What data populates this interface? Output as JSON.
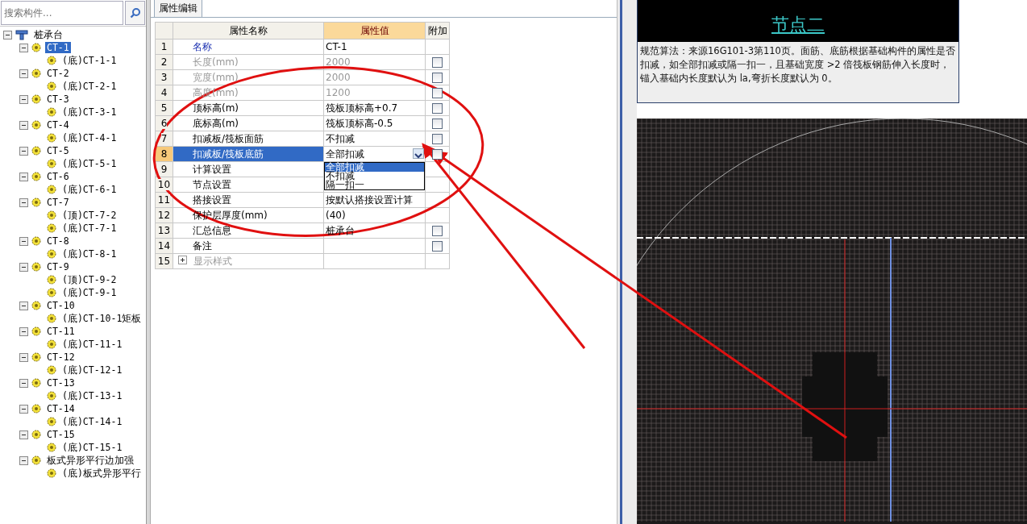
{
  "search": {
    "placeholder": "搜索构件..."
  },
  "tree": [
    {
      "label": "桩承台",
      "kind": "root",
      "expanded": true,
      "selected": false,
      "children": [
        {
          "label": "CT-1",
          "kind": "group",
          "expanded": true,
          "selected": true,
          "children": [
            {
              "label": "(底)CT-1-1",
              "kind": "leaf",
              "selected": false
            }
          ]
        },
        {
          "label": "CT-2",
          "kind": "group",
          "expanded": true,
          "selected": false,
          "children": [
            {
              "label": "(底)CT-2-1",
              "kind": "leaf",
              "selected": false
            }
          ]
        },
        {
          "label": "CT-3",
          "kind": "group",
          "expanded": true,
          "selected": false,
          "children": [
            {
              "label": "(底)CT-3-1",
              "kind": "leaf",
              "selected": false
            }
          ]
        },
        {
          "label": "CT-4",
          "kind": "group",
          "expanded": true,
          "selected": false,
          "children": [
            {
              "label": "(底)CT-4-1",
              "kind": "leaf",
              "selected": false
            }
          ]
        },
        {
          "label": "CT-5",
          "kind": "group",
          "expanded": true,
          "selected": false,
          "children": [
            {
              "label": "(底)CT-5-1",
              "kind": "leaf",
              "selected": false
            }
          ]
        },
        {
          "label": "CT-6",
          "kind": "group",
          "expanded": true,
          "selected": false,
          "children": [
            {
              "label": "(底)CT-6-1",
              "kind": "leaf",
              "selected": false
            }
          ]
        },
        {
          "label": "CT-7",
          "kind": "group",
          "expanded": true,
          "selected": false,
          "children": [
            {
              "label": "(顶)CT-7-2",
              "kind": "leaf",
              "selected": false
            },
            {
              "label": "(底)CT-7-1",
              "kind": "leaf",
              "selected": false
            }
          ]
        },
        {
          "label": "CT-8",
          "kind": "group",
          "expanded": true,
          "selected": false,
          "children": [
            {
              "label": "(底)CT-8-1",
              "kind": "leaf",
              "selected": false
            }
          ]
        },
        {
          "label": "CT-9",
          "kind": "group",
          "expanded": true,
          "selected": false,
          "children": [
            {
              "label": "(顶)CT-9-2",
              "kind": "leaf",
              "selected": false
            },
            {
              "label": "(底)CT-9-1",
              "kind": "leaf",
              "selected": false
            }
          ]
        },
        {
          "label": "CT-10",
          "kind": "group",
          "expanded": true,
          "selected": false,
          "children": [
            {
              "label": "(底)CT-10-1矩板",
              "kind": "leaf",
              "selected": false
            }
          ]
        },
        {
          "label": "CT-11",
          "kind": "group",
          "expanded": true,
          "selected": false,
          "children": [
            {
              "label": "(底)CT-11-1",
              "kind": "leaf",
              "selected": false
            }
          ]
        },
        {
          "label": "CT-12",
          "kind": "group",
          "expanded": true,
          "selected": false,
          "children": [
            {
              "label": "(底)CT-12-1",
              "kind": "leaf",
              "selected": false
            }
          ]
        },
        {
          "label": "CT-13",
          "kind": "group",
          "expanded": true,
          "selected": false,
          "children": [
            {
              "label": "(底)CT-13-1",
              "kind": "leaf",
              "selected": false
            }
          ]
        },
        {
          "label": "CT-14",
          "kind": "group",
          "expanded": true,
          "selected": false,
          "children": [
            {
              "label": "(底)CT-14-1",
              "kind": "leaf",
              "selected": false
            }
          ]
        },
        {
          "label": "CT-15",
          "kind": "group",
          "expanded": true,
          "selected": false,
          "children": [
            {
              "label": "(底)CT-15-1",
              "kind": "leaf",
              "selected": false
            }
          ]
        },
        {
          "label": "板式异形平行边加强",
          "kind": "group",
          "expanded": true,
          "selected": false,
          "children": [
            {
              "label": "(底)板式异形平行",
              "kind": "leaf",
              "selected": false
            }
          ]
        }
      ]
    }
  ],
  "tabs": [
    {
      "label": "属性编辑",
      "selected": true
    }
  ],
  "table": {
    "columns": [
      "属性名称",
      "属性值",
      "附加"
    ],
    "rows": [
      {
        "num": "1",
        "name": "名称",
        "value": "CT-1",
        "kind": "link",
        "selected": false
      },
      {
        "num": "2",
        "name": "长度(mm)",
        "value": "2000",
        "kind": "disabled",
        "selected": false,
        "attach": {
          "checked": false
        }
      },
      {
        "num": "3",
        "name": "宽度(mm)",
        "value": "2000",
        "kind": "disabled",
        "selected": false,
        "attach": {
          "checked": false
        }
      },
      {
        "num": "4",
        "name": "高度(mm)",
        "value": "1200",
        "kind": "disabled",
        "selected": false,
        "attach": {
          "checked": false
        }
      },
      {
        "num": "5",
        "name": "顶标高(m)",
        "value": "筏板顶标高+0.7",
        "kind": "normal",
        "selected": false,
        "attach": {
          "checked": false
        }
      },
      {
        "num": "6",
        "name": "底标高(m)",
        "value": "筏板顶标高-0.5",
        "kind": "normal",
        "selected": false,
        "attach": {
          "checked": false
        }
      },
      {
        "num": "7",
        "name": "扣减板/筏板面筋",
        "value": "不扣减",
        "kind": "normal",
        "selected": false,
        "attach": {
          "checked": false
        }
      },
      {
        "num": "8",
        "name": "扣减板/筏板底筋",
        "value": "全部扣减",
        "kind": "dropdown",
        "selected": true,
        "attach": {
          "checked": false
        },
        "options": [
          {
            "label": "全部扣减",
            "selected": true
          },
          {
            "label": "不扣减",
            "selected": false
          },
          {
            "label": "隔一扣一",
            "selected": false
          }
        ]
      },
      {
        "num": "9",
        "name": "计算设置",
        "value": "",
        "kind": "normal",
        "selected": false
      },
      {
        "num": "10",
        "name": "节点设置",
        "value": "",
        "kind": "normal",
        "selected": false
      },
      {
        "num": "11",
        "name": "搭接设置",
        "value": "按默认搭接设置计算",
        "kind": "normal",
        "selected": false
      },
      {
        "num": "12",
        "name": "保护层厚度(mm)",
        "value": "(40)",
        "kind": "normal",
        "selected": false
      },
      {
        "num": "13",
        "name": "汇总信息",
        "value": "桩承台",
        "kind": "normal",
        "selected": false,
        "attach": {
          "checked": false
        }
      },
      {
        "num": "14",
        "name": "备注",
        "value": "",
        "kind": "normal",
        "selected": false,
        "attach": {
          "checked": false
        }
      },
      {
        "num": "15",
        "name": "显示样式",
        "value": "",
        "kind": "group",
        "expanded": false,
        "selected": false
      }
    ]
  },
  "info": {
    "title": "节点二",
    "text": "规范算法：来源16G101-3第110页。面筋、底筋根据基础构件的属性是否扣减，如全部扣减或隔一扣一，且基础宽度 >2 倍筏板钢筋伸入长度时，锚入基础内长度默认为 la,弯折长度默认为 0。"
  }
}
